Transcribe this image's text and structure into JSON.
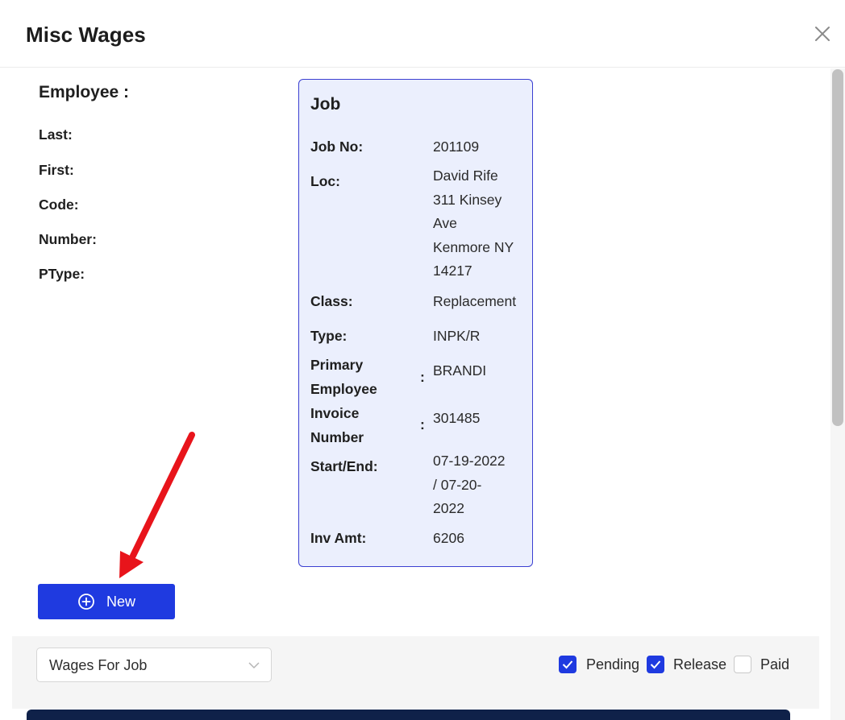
{
  "dialog": {
    "title": "Misc Wages"
  },
  "employee": {
    "heading": "Employee :",
    "fields": [
      {
        "label": "Last",
        "colon": ":"
      },
      {
        "label": "First",
        "colon": ":"
      },
      {
        "label": "Code",
        "colon": ":"
      },
      {
        "label": "Number",
        "colon": ":"
      },
      {
        "label": "PType",
        "colon": ":"
      }
    ]
  },
  "job": {
    "title": "Job",
    "colon": ":",
    "job_no": {
      "label": "Job No",
      "value": "201109"
    },
    "loc": {
      "label": "Loc",
      "lines": [
        "David Rife",
        "311 Kinsey",
        "Ave",
        "Kenmore NY",
        "14217"
      ]
    },
    "class": {
      "label": "Class",
      "value": "Replacement"
    },
    "type": {
      "label": "Type",
      "value": "INPK/R"
    },
    "primary_employee": {
      "label": "Primary Employee",
      "value": "BRANDI"
    },
    "invoice_number": {
      "label": "Invoice Number",
      "value": "301485"
    },
    "start_end": {
      "label": "Start/End",
      "lines": [
        "07-19-2022",
        "/ 07-20-",
        "2022"
      ]
    },
    "inv_amt": {
      "label": "Inv Amt",
      "value": "6206"
    }
  },
  "actions": {
    "new_label": "New"
  },
  "filter": {
    "select_value": "Wages For Job",
    "pending": {
      "label": "Pending",
      "checked": true
    },
    "release": {
      "label": "Release",
      "checked": true
    },
    "paid": {
      "label": "Paid",
      "checked": false
    }
  },
  "colors": {
    "primary": "#1f3ae0",
    "card_bg": "#ebeffd",
    "card_border": "#3b3fd1",
    "arrow": "#e8141b",
    "table_header": "#0f2149"
  }
}
